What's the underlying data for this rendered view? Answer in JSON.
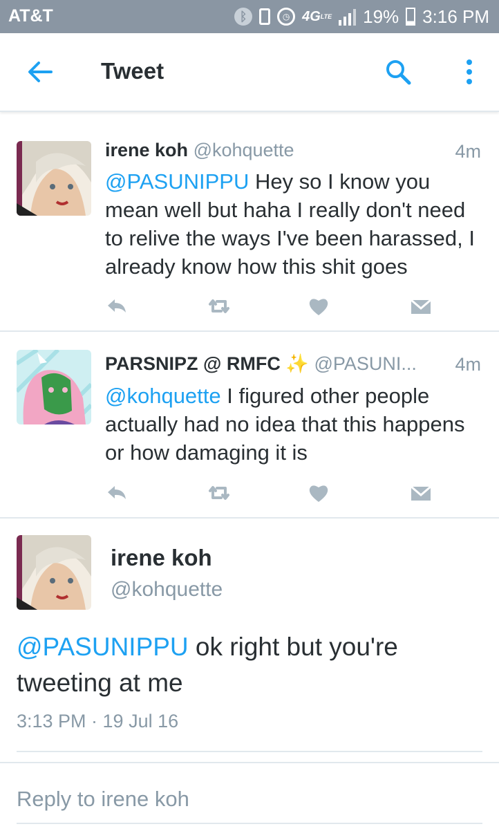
{
  "status_bar": {
    "carrier": "AT&T",
    "network": "4G",
    "network_sub": "LTE",
    "battery": "19%",
    "time": "3:16 PM",
    "icons": [
      "bluetooth-icon",
      "vibrate-icon",
      "alarm-icon",
      "signal-icon",
      "battery-icon"
    ]
  },
  "app_bar": {
    "title": "Tweet",
    "icons": [
      "back-arrow-icon",
      "search-icon",
      "more-vertical-icon"
    ]
  },
  "tweets": [
    {
      "name": "irene koh",
      "handle": "@kohquette",
      "time": "4m",
      "mention": "@PASUNIPPU",
      "text": " Hey so I know you mean well but haha I really don't need to relive the ways I've been harassed, I already know how this shit goes"
    },
    {
      "name": "PARSNIPZ @ RMFC",
      "badge": "✨",
      "handle": "@PASUNI...",
      "time": "4m",
      "mention": "@kohquette",
      "text": " I figured other people actually had no idea that this happens or how damaging it is"
    }
  ],
  "main_tweet": {
    "name": "irene koh",
    "handle": "@kohquette",
    "mention": "@PASUNIPPU",
    "text": " ok right but you're tweeting at me",
    "timestamp": "3:13 PM · 19 Jul 16"
  },
  "reply_box": {
    "placeholder": "Reply to irene koh"
  },
  "colors": {
    "accent": "#1da1f2",
    "status_bar": "#8a96a3",
    "muted": "#8899a6",
    "text": "#292f33",
    "divider": "#e1e8ed"
  }
}
